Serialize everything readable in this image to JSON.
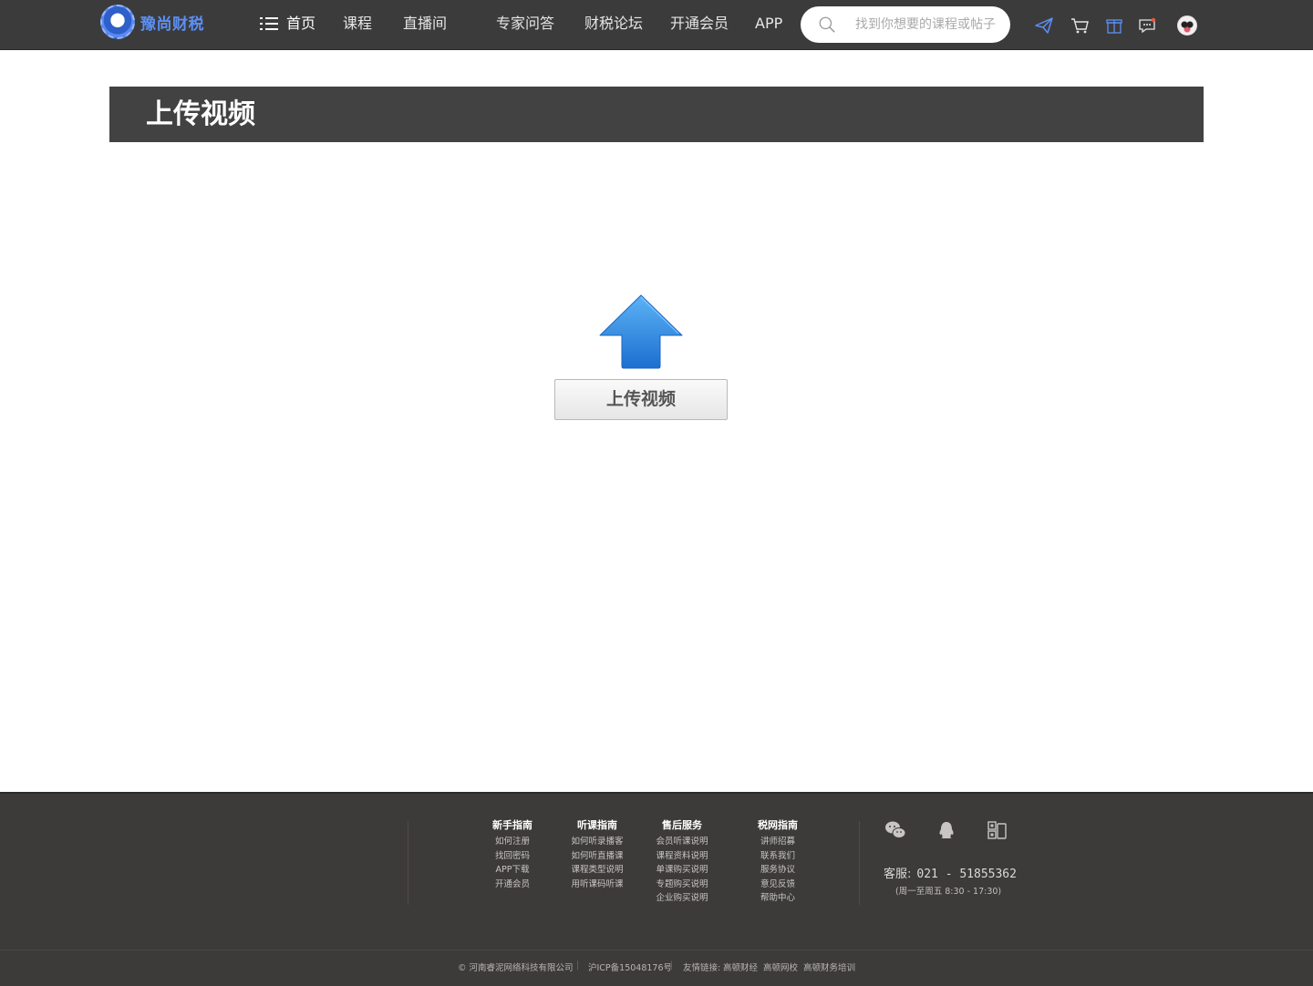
{
  "header": {
    "brand": "豫尚财税",
    "nav": [
      {
        "label": "首页"
      },
      {
        "label": "课程"
      },
      {
        "label": "直播间"
      },
      {
        "label": "专家问答"
      },
      {
        "label": "财税论坛"
      },
      {
        "label": "开通会员"
      },
      {
        "label": "APP"
      }
    ],
    "search_placeholder": "找到你想要的课程或帖子",
    "icons": [
      "send-icon",
      "cart-icon",
      "gift-icon",
      "message-icon"
    ],
    "accent_color": "#5b8ff5"
  },
  "page": {
    "title": "上传视频",
    "upload_button_label": "上传视频",
    "upload_arrow_color": "#2f8be0"
  },
  "footer": {
    "columns": [
      {
        "heading": "新手指南",
        "links": [
          "如何注册",
          "找回密码",
          "APP下载",
          "开通会员"
        ]
      },
      {
        "heading": "听课指南",
        "links": [
          "如何听录播客",
          "如何听直播课",
          "课程类型说明",
          "用听课码听课"
        ]
      },
      {
        "heading": "售后服务",
        "links": [
          "会员听课说明",
          "课程资料说明",
          "单课购买说明",
          "专题购买说明",
          "企业购买说明"
        ]
      },
      {
        "heading": "税网指南",
        "links": [
          "讲师招募",
          "联系我们",
          "服务协议",
          "意见反馈",
          "帮助中心"
        ]
      }
    ],
    "social_icons": [
      "wechat-icon",
      "qq-icon",
      "mobile-qr-icon"
    ],
    "hotline_label": "客服:",
    "hotline_number": "021 - 51855362",
    "hours": "(周一至周五  8:30 - 17:30)",
    "company": "© 河南睿泥网络科技有限公司",
    "icp": "沪ICP备15048176号",
    "friend_links_label": "友情链接:",
    "friend_links": [
      "高顿财经",
      "高顿网校",
      "高顿财务培训"
    ]
  }
}
